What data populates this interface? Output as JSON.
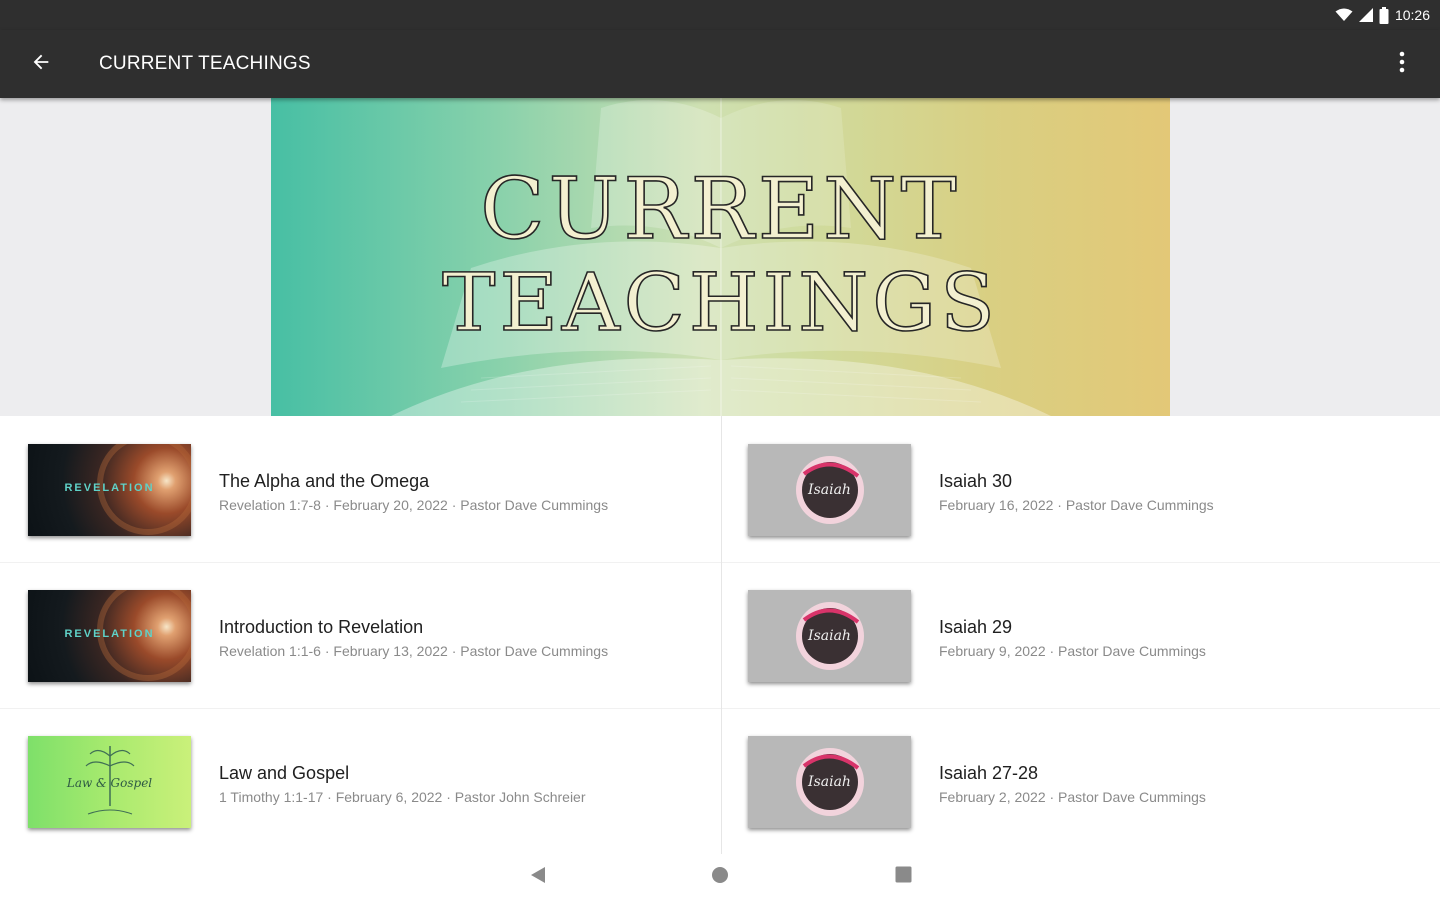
{
  "status_bar": {
    "time": "10:26"
  },
  "app_bar": {
    "title": "CURRENT TEACHINGS"
  },
  "hero": {
    "line1": "CURRENT",
    "line2": "TEACHINGS"
  },
  "teachings": [
    {
      "title": "The Alpha and the Omega",
      "subtitle": "Revelation 1:7-8 · February 20, 2022 · Pastor Dave Cummings",
      "thumb": "revelation",
      "thumb_text": "REVELATION"
    },
    {
      "title": "Isaiah 30",
      "subtitle": "February 16, 2022 · Pastor Dave Cummings",
      "thumb": "isaiah",
      "thumb_text": "Isaiah"
    },
    {
      "title": "Introduction to Revelation",
      "subtitle": "Revelation 1:1-6 · February 13, 2022 · Pastor Dave Cummings",
      "thumb": "revelation",
      "thumb_text": "REVELATION"
    },
    {
      "title": "Isaiah 29",
      "subtitle": "February 9, 2022 · Pastor Dave Cummings",
      "thumb": "isaiah",
      "thumb_text": "Isaiah"
    },
    {
      "title": "Law and Gospel",
      "subtitle": "1 Timothy 1:1-17 · February 6, 2022 · Pastor John Schreier",
      "thumb": "law-gospel",
      "thumb_text": "Law & Gospel"
    },
    {
      "title": "Isaiah 27-28",
      "subtitle": "February 2, 2022 · Pastor Dave Cummings",
      "thumb": "isaiah",
      "thumb_text": "Isaiah"
    }
  ],
  "icons": {
    "back": "arrow-left-icon",
    "overflow": "more-vert-icon",
    "wifi": "wifi-icon",
    "signal": "signal-icon",
    "battery": "battery-icon",
    "nav_back": "triangle-back-icon",
    "nav_home": "circle-home-icon",
    "nav_recents": "square-recents-icon"
  },
  "colors": {
    "app_bar": "#2f2f2f",
    "hero_left": "#47bfa4",
    "hero_right": "#e3c877",
    "title_text": "#202020",
    "subtitle_text": "#8a8a8a"
  }
}
